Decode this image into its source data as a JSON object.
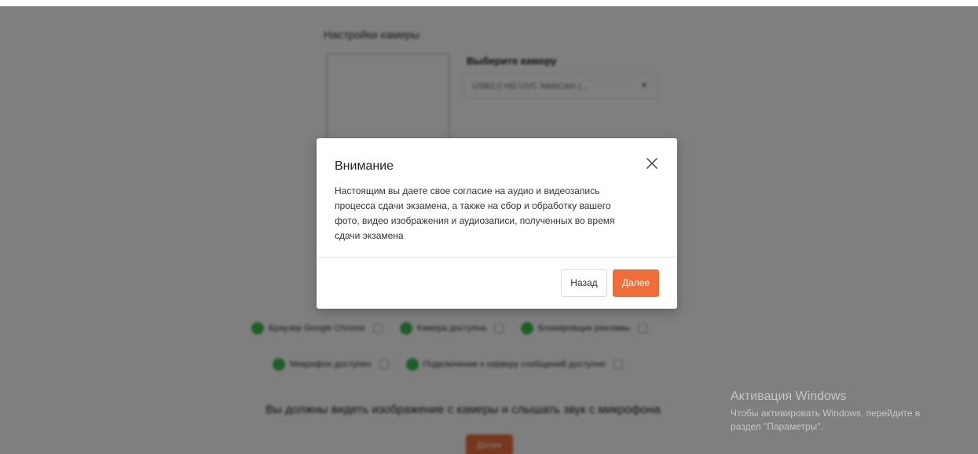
{
  "background": {
    "section_title": "Настройки камеры",
    "camera_select_label": "Выберите камеру",
    "camera_select_value": "USB2.0 HD UVC WebCam (...",
    "checks_row1": [
      {
        "label": "Браузер Google Chrome",
        "status_color": "#3bbd4a"
      },
      {
        "label": "Камера доступна",
        "status_color": "#3bbd4a"
      },
      {
        "label": "Блокировщик рекламы",
        "status_color": "#3bbd4a"
      }
    ],
    "checks_row2": [
      {
        "label": "Микрофон доступен",
        "status_color": "#3bbd4a"
      },
      {
        "label": "Подключение к серверу сообщений доступно",
        "status_color": "#3bbd4a"
      }
    ],
    "instruction": "Вы должны видеть изображение с камеры и слышать звук с микрофона",
    "start_button": "Далее"
  },
  "modal": {
    "title": "Внимание",
    "close_icon": "close-icon",
    "body_lines": [
      "Настоящим вы даете свое согласие на аудио и видеозапись",
      "процесса сдачи экзамена, а также на сбор и обработку вашего",
      "фото, видео изображения и аудиозаписи, полученных во время",
      "сдачи экзамена"
    ],
    "back_label": "Назад",
    "next_label": "Далее",
    "accent_color": "#ee6e3a"
  },
  "watermark": {
    "title": "Активация Windows",
    "line1": "Чтобы активировать Windows, перейдите в",
    "line2": "раздел \"Параметры\"."
  }
}
